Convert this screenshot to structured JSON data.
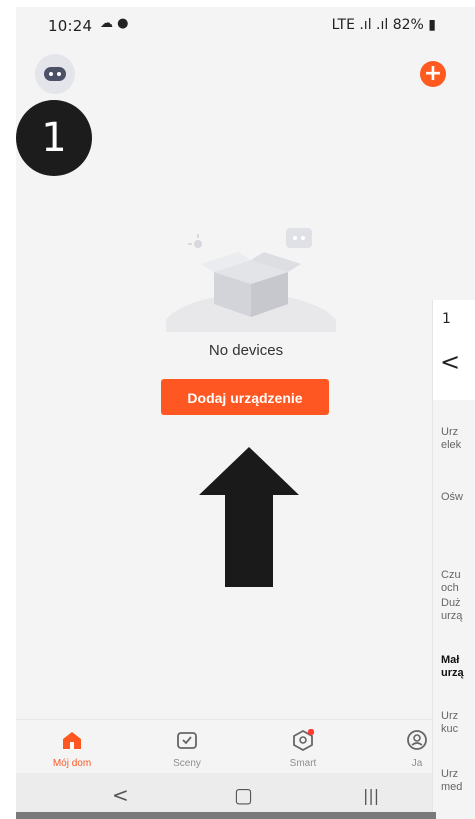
{
  "status_bar": {
    "time": "10:24",
    "left_icons": "☁ ●",
    "right_text": "LTE .ıl .ıl 82% ▮"
  },
  "header": {
    "avatar_icon": "robot-avatar-icon",
    "add_icon": "+"
  },
  "annotation": {
    "step_number": "1"
  },
  "empty_state": {
    "message": "No devices",
    "add_button_label": "Dodaj urządzenie"
  },
  "overlay_panel": {
    "time": "1",
    "back_icon": "<",
    "items": [
      "Urz",
      "elek",
      "Ośw",
      "Czu",
      "och",
      "Duż",
      "urzą",
      "Mał",
      "urzą",
      "Urz",
      "kuc",
      "Urz",
      "med"
    ]
  },
  "tabs": [
    {
      "label": "Mój dom",
      "icon": "home-icon",
      "active": true
    },
    {
      "label": "Sceny",
      "icon": "scenes-icon",
      "active": false
    },
    {
      "label": "Smart",
      "icon": "smart-icon",
      "active": false,
      "badge": true
    },
    {
      "label": "Ja",
      "icon": "profile-icon",
      "active": false
    }
  ],
  "nav_bar": {
    "back": "<",
    "home": "▢",
    "recents": "|||"
  },
  "colors": {
    "accent": "#ff5722",
    "background": "#f4f4f5",
    "badge": "#1c1c1c"
  }
}
